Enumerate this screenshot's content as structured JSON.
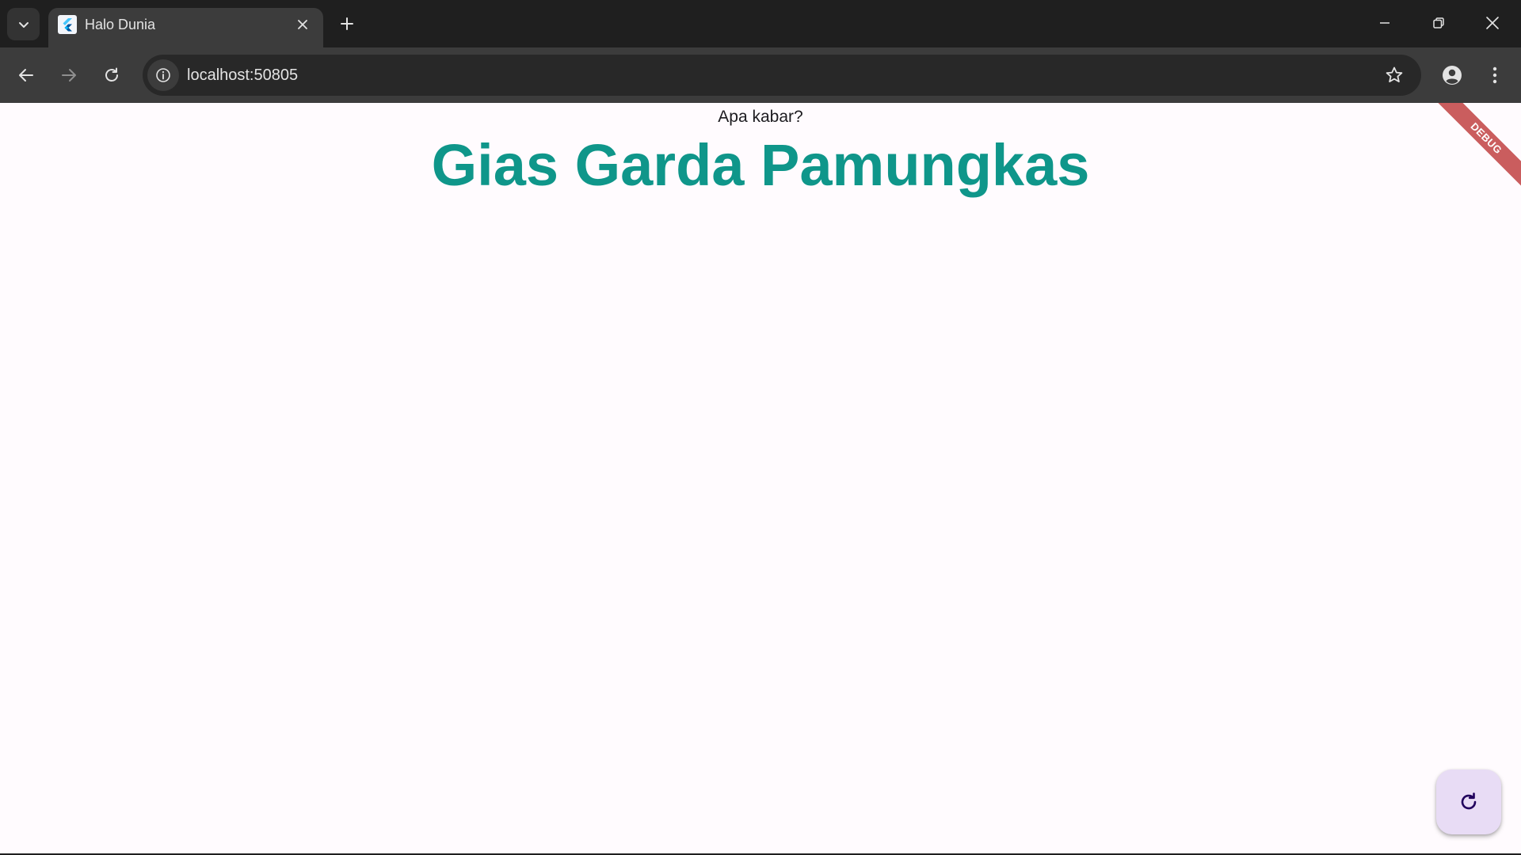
{
  "browser": {
    "tab": {
      "title": "Halo Dunia",
      "favicon": "flutter-logo-icon"
    },
    "window_controls": [
      "minimize-icon",
      "restore-icon",
      "close-icon"
    ],
    "address_bar": {
      "url": "localhost:50805",
      "site_info_icon": "info-icon"
    },
    "colors": {
      "frame": "#1f1f1f",
      "toolbar": "#3c3c3c",
      "omnibox": "#282828",
      "text": "#e3e3e3"
    }
  },
  "app": {
    "greeting": "Apa kabar?",
    "name": "Gias Garda Pamungkas",
    "debug_banner": "DEBUG",
    "fab_icon": "refresh-icon",
    "colors": {
      "background": "#fffbfe",
      "heading": "#0f968a",
      "fab": "#e8dcf5",
      "fab_icon": "#21005d",
      "debug_banner": "#b82828"
    }
  }
}
